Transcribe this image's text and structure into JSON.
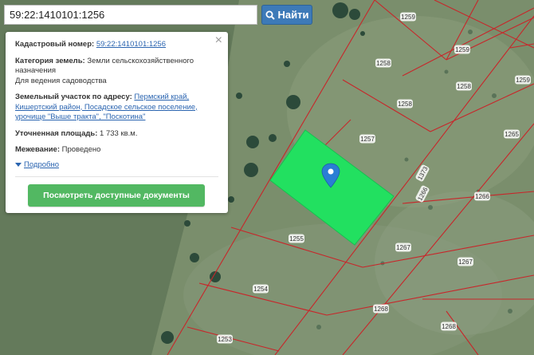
{
  "search": {
    "value": "59:22:1410101:1256",
    "button_label": "Найти",
    "button_icon": "search-icon"
  },
  "info": {
    "cad_label": "Кадастровый номер:",
    "cad_value": "59:22:1410101:1256",
    "category_label": "Категория земель:",
    "category_value_line1": "Земли сельскохозяйственного",
    "category_value_line2": "назначения",
    "category_use": "Для ведения садоводства",
    "address_label": "Земельный участок по адресу:",
    "address_link1": "Пермский край,",
    "address_link2": "Кишертский район, Посадское сельское поселение,",
    "address_link3": "урочище \"Выше тракта\", \"Поскотина\"",
    "area_label": "Уточненная площадь:",
    "area_value": "1 733 кв.м.",
    "survey_label": "Межевание:",
    "survey_value": "Проведено",
    "details_link": "Подробно",
    "docs_button": "Посмотреть доступные документы",
    "close_symbol": "×"
  },
  "parcels": [
    {
      "label": "1259"
    },
    {
      "label": "1259"
    },
    {
      "label": "1258"
    },
    {
      "label": "1259"
    },
    {
      "label": "1258"
    },
    {
      "label": "1258"
    },
    {
      "label": "1257"
    },
    {
      "label": "1265"
    },
    {
      "label": "1373"
    },
    {
      "label": "1266"
    },
    {
      "label": "1266"
    },
    {
      "label": "1255"
    },
    {
      "label": "1267"
    },
    {
      "label": "1267"
    },
    {
      "label": "1254"
    },
    {
      "label": "1268"
    },
    {
      "label": "1268"
    },
    {
      "label": "1253"
    }
  ],
  "colors": {
    "parcel_border": "#c8262a",
    "selected_fill": "#22e060",
    "marker": "#2a7ed4",
    "button_blue": "#3d7ab8",
    "button_green": "#52b862"
  }
}
